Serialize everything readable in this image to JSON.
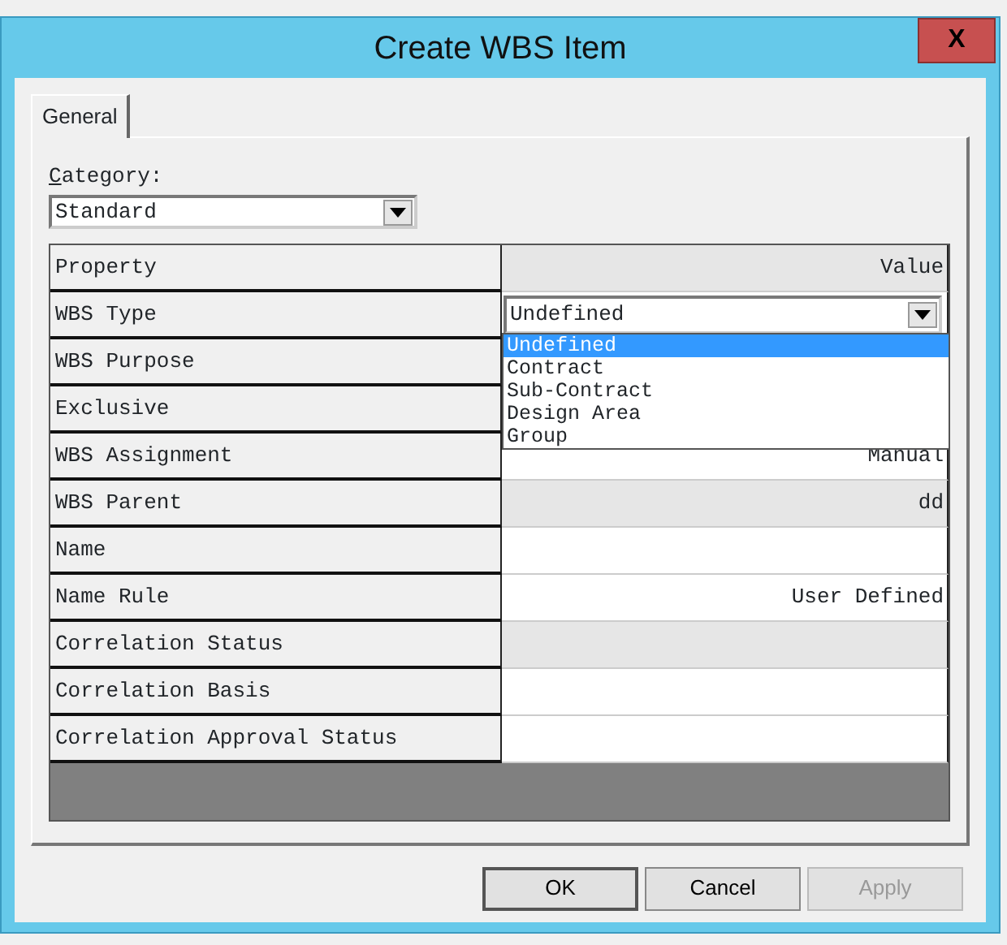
{
  "window": {
    "title": "Create WBS Item",
    "close": "X"
  },
  "tabs": [
    {
      "label": "General",
      "selected": true
    }
  ],
  "category": {
    "label": "Category:",
    "value": "Standard"
  },
  "grid": {
    "columns": [
      "Property",
      "Value"
    ],
    "rows": [
      {
        "property": "WBS Type",
        "kind": "combo",
        "value": "Undefined",
        "readonly": false
      },
      {
        "property": "WBS Purpose",
        "kind": "text"
      },
      {
        "property": "Exclusive",
        "kind": "text"
      },
      {
        "property": "WBS Assignment",
        "kind": "text",
        "value": "Manual",
        "readonly": false
      },
      {
        "property": "WBS Parent",
        "kind": "text",
        "value": "dd",
        "readonly": true
      },
      {
        "property": "Name",
        "kind": "text",
        "readonly": false
      },
      {
        "property": "Name Rule",
        "kind": "text",
        "value": "User Defined",
        "readonly": false
      },
      {
        "property": "Correlation Status",
        "kind": "text",
        "readonly": true
      },
      {
        "property": "Correlation Basis",
        "kind": "text",
        "readonly": false
      },
      {
        "property": "Correlation Approval Status",
        "kind": "text",
        "readonly": false
      }
    ],
    "dropdown": [
      {
        "label": "Undefined",
        "selected": true
      },
      {
        "label": "Contract",
        "selected": false
      },
      {
        "label": "Sub-Contract",
        "selected": false
      },
      {
        "label": "Design Area",
        "selected": false
      },
      {
        "label": "Group",
        "selected": false
      }
    ]
  },
  "buttons": [
    {
      "label": "OK",
      "disabled": false
    },
    {
      "label": "Cancel",
      "disabled": false
    },
    {
      "label": "Apply",
      "disabled": true
    }
  ]
}
